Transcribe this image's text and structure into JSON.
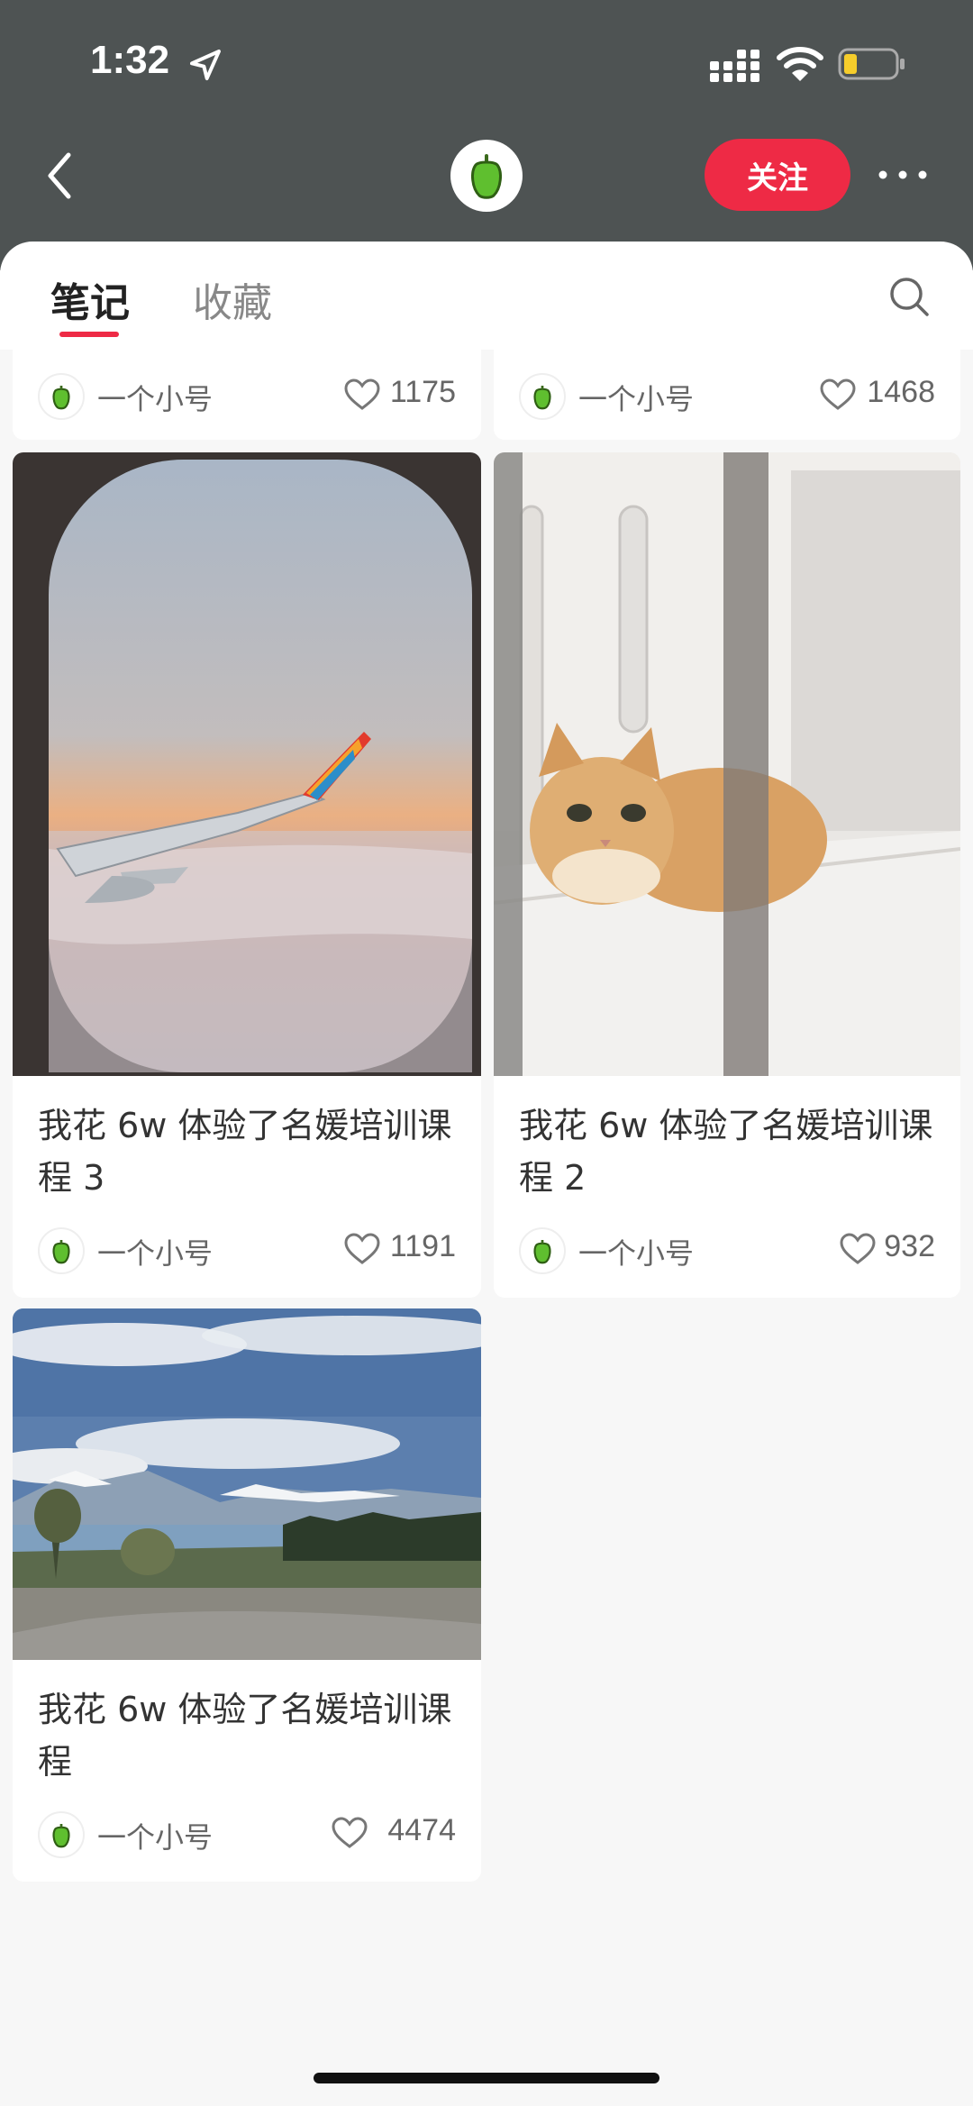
{
  "status": {
    "time": "1:32"
  },
  "header": {
    "follow_label": "关注"
  },
  "tabs": [
    {
      "label": "笔记"
    },
    {
      "label": "收藏"
    }
  ],
  "cards": [
    {
      "title": "",
      "author": "一个小号",
      "likes": "1175"
    },
    {
      "title": "",
      "author": "一个小号",
      "likes": "1468"
    },
    {
      "title": "我花 6w 体验了名媛培训课程 3",
      "author": "一个小号",
      "likes": "1191"
    },
    {
      "title": "我花 6w 体验了名媛培训课程 2",
      "author": "一个小号",
      "likes": "932"
    },
    {
      "title": "我花 6w 体验了名媛培训课程",
      "author": "一个小号",
      "likes": "4474"
    }
  ],
  "colors": {
    "accent": "#ee2a45",
    "header_bg": "#4e5353",
    "page_bg": "#f7f7f7"
  },
  "icons": [
    "location-arrow-icon",
    "signal-icon",
    "wifi-icon",
    "battery-icon",
    "back-arrow-icon",
    "pepper-avatar-icon",
    "more-icon",
    "search-icon",
    "heart-icon"
  ]
}
